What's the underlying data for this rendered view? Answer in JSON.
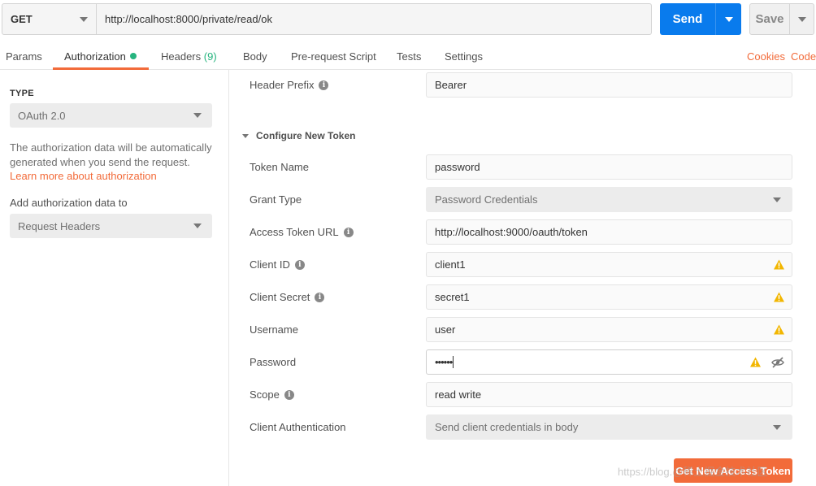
{
  "request": {
    "method": "GET",
    "url": "http://localhost:8000/private/read/ok",
    "send_label": "Send",
    "save_label": "Save"
  },
  "tabs": [
    {
      "label": "Params"
    },
    {
      "label": "Authorization"
    },
    {
      "label": "Headers",
      "count": "(9)"
    },
    {
      "label": "Body"
    },
    {
      "label": "Pre-request Script"
    },
    {
      "label": "Tests"
    },
    {
      "label": "Settings"
    }
  ],
  "links": {
    "cookies": "Cookies",
    "code": "Code"
  },
  "auth": {
    "type_label": "TYPE",
    "type_value": "OAuth 2.0",
    "description": "The authorization data will be automatically generated when you send the request.",
    "learn_more": "Learn more about authorization",
    "add_to_label": "Add authorization data to",
    "add_to_value": "Request Headers"
  },
  "form": {
    "header_prefix_label": "Header Prefix",
    "header_prefix_value": "Bearer",
    "configure_label": "Configure New Token",
    "token_name_label": "Token Name",
    "token_name_value": "password",
    "grant_type_label": "Grant Type",
    "grant_type_value": "Password Credentials",
    "access_token_url_label": "Access Token URL",
    "access_token_url_value": "http://localhost:9000/oauth/token",
    "client_id_label": "Client ID",
    "client_id_value": "client1",
    "client_secret_label": "Client Secret",
    "client_secret_value": "secret1",
    "username_label": "Username",
    "username_value": "user",
    "password_label": "Password",
    "password_value": "••••••",
    "scope_label": "Scope",
    "scope_value": "read write",
    "client_auth_label": "Client Authentication",
    "client_auth_value": "Send client credentials in body",
    "get_token_label": "Get New Access Token"
  },
  "watermark": "https://blog.@稀土掘金技术社区",
  "colors": {
    "accent": "#f26b3a",
    "send": "#097bed",
    "success": "#26b47f",
    "warning": "#f2b600"
  },
  "icons": {
    "info": "info-icon",
    "warning": "warning-icon",
    "eye": "eye-slash-icon",
    "caret": "chevron-down-icon"
  }
}
